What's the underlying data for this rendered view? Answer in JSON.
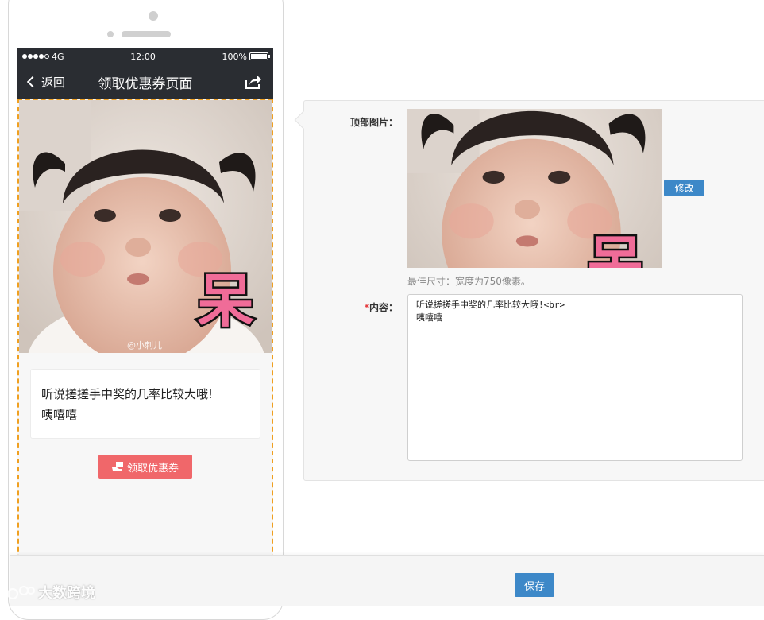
{
  "phone": {
    "statusbar": {
      "signal": "4G",
      "time": "12:00",
      "battery": "100%"
    },
    "navbar": {
      "back_label": "返回",
      "title": "领取优惠券页面"
    },
    "image_badge": "呆",
    "image_watermark": "@小刺儿",
    "content_lines": [
      "听说搓搓手中奖的几率比较大哦!",
      "咦嘻嘻"
    ],
    "coupon_button": "领取优惠券"
  },
  "panel": {
    "top_image_label": "顶部图片：",
    "edit_button": "修改",
    "size_hint": "最佳尺寸：宽度为750像素。",
    "content_label_required": "*",
    "content_label": "内容：",
    "content_value": "听说搓搓手中奖的几率比较大哦!<br>\n咦嘻嘻"
  },
  "footer": {
    "save_button": "保存"
  },
  "watermark": "大数跨境",
  "colors": {
    "navbar": "#2a2d32",
    "dashed_border": "#f0a020",
    "coupon_button": "#f0676a",
    "primary_button": "#3d88c8",
    "required_mark": "#e4393c"
  }
}
